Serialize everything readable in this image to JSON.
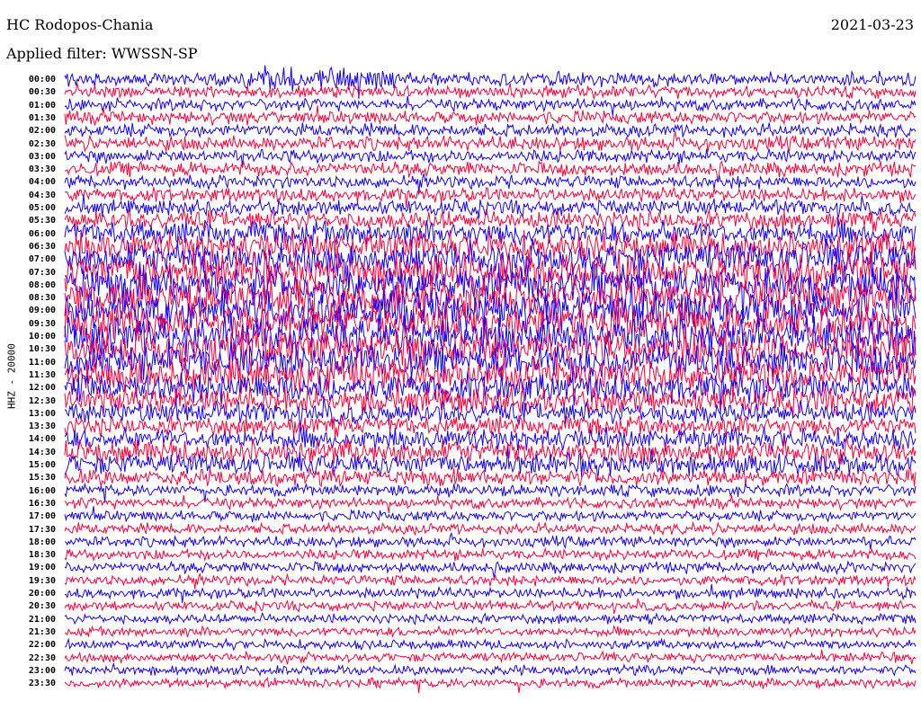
{
  "header": {
    "station": "HC Rodopos-Chania",
    "filter": "Applied filter: WWSSN-SP",
    "date": "2021-03-23",
    "channel_label": "HHZ - 20000"
  },
  "colors": {
    "trace_a": "#1400ff",
    "trace_b": "#ff0038",
    "background": "#ffffff",
    "text": "#000000"
  },
  "chart_data": {
    "type": "line",
    "title": "HC Rodopos-Chania",
    "subtitle": "Applied filter: WWSSN-SP",
    "ylabel": "HHZ - 20000",
    "row_labels": [
      "00:00",
      "00:30",
      "01:00",
      "01:30",
      "02:00",
      "02:30",
      "03:00",
      "03:30",
      "04:00",
      "04:30",
      "05:00",
      "05:30",
      "06:00",
      "06:30",
      "07:00",
      "07:30",
      "08:00",
      "08:30",
      "09:00",
      "09:30",
      "10:00",
      "10:30",
      "11:00",
      "11:30",
      "12:00",
      "12:30",
      "13:00",
      "13:30",
      "14:00",
      "14:30",
      "15:00",
      "15:30",
      "16:00",
      "16:30",
      "17:00",
      "17:30",
      "18:00",
      "18:30",
      "19:00",
      "19:30",
      "20:00",
      "20:30",
      "21:00",
      "21:30",
      "22:00",
      "22:30",
      "23:00",
      "23:30"
    ],
    "row_colors": [
      "blue",
      "red",
      "blue",
      "red",
      "blue",
      "red",
      "blue",
      "red",
      "blue",
      "red",
      "blue",
      "red",
      "blue",
      "red",
      "blue",
      "red",
      "blue",
      "red",
      "blue",
      "red",
      "blue",
      "red",
      "blue",
      "red",
      "blue",
      "red",
      "blue",
      "red",
      "blue",
      "red",
      "blue",
      "red",
      "blue",
      "red",
      "blue",
      "red",
      "blue",
      "red",
      "blue",
      "red",
      "blue",
      "red",
      "blue",
      "red",
      "blue",
      "red",
      "blue",
      "red"
    ],
    "relative_amplitude": [
      1.2,
      1.0,
      1.0,
      1.1,
      1.1,
      1.2,
      1.1,
      1.2,
      1.1,
      1.2,
      1.3,
      1.6,
      2.0,
      2.4,
      2.8,
      3.0,
      3.2,
      3.2,
      3.3,
      3.2,
      3.2,
      3.1,
      3.0,
      2.8,
      2.5,
      2.2,
      1.8,
      1.6,
      1.8,
      2.0,
      1.8,
      1.4,
      1.0,
      0.9,
      0.9,
      0.9,
      0.9,
      0.9,
      0.9,
      0.9,
      0.9,
      0.8,
      0.8,
      0.8,
      0.8,
      0.8,
      0.8,
      0.8
    ],
    "grid": false,
    "legend": "none"
  }
}
